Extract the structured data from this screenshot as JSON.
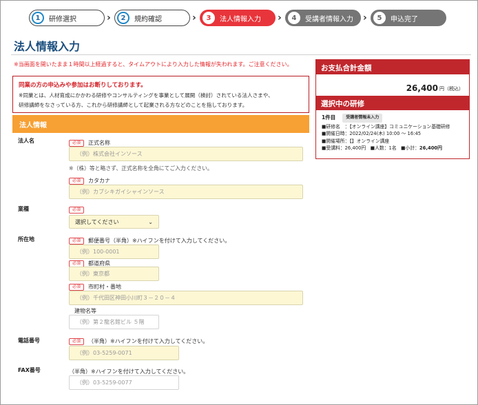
{
  "stepper": [
    {
      "num": "1",
      "label": "研修選択"
    },
    {
      "num": "2",
      "label": "規約確認"
    },
    {
      "num": "3",
      "label": "法人情報入力"
    },
    {
      "num": "4",
      "label": "受講者情報入力"
    },
    {
      "num": "5",
      "label": "申込完了"
    }
  ],
  "page_title": "法人情報入力",
  "timeout_warning": "※当画面を開いたまま１時間以上経過すると、タイムアウトにより入力した情報が失われます。ご注意ください。",
  "notice": {
    "heading": "同業の方の申込みや参加はお断りしております。",
    "body_line1": "※同業とは、人材育成にかかわる研修やコンサルティングを事業として展開（検討）されている法人さまや、",
    "body_line2": "研修講師をなさっている方、これから研修講師として起業される方などのことを指しております。"
  },
  "section_title": "法人情報",
  "required_badge": "必須",
  "form": {
    "company": {
      "label": "法人名",
      "name_label": "正式名称",
      "name_placeholder": "（例）株式会社インソース",
      "name_note": "※（株）等と略さず、正式名称を全角にてご入力ください。",
      "kana_label": "カタカナ",
      "kana_placeholder": "（例）カブシキガイシャインソース"
    },
    "industry": {
      "label": "業種",
      "select_value": "選択してください"
    },
    "address": {
      "label": "所在地",
      "zip_label": "郵便番号（半角）※ハイフンを付けて入力してください。",
      "zip_placeholder": "（例）100-0001",
      "pref_label": "都道府県",
      "pref_placeholder": "（例）東京都",
      "city_label": "市町村・番地",
      "city_placeholder": "（例）千代田区神田小川町３－２０－４",
      "building_label": "建物名等",
      "building_placeholder": "（例）第２龍名館ビル ５階"
    },
    "phone": {
      "label": "電話番号",
      "hint": "（半角）※ハイフンを付けて入力してください。",
      "placeholder": "（例）03-5259-0071"
    },
    "fax": {
      "label": "FAX番号",
      "hint": "（半角）※ハイフンを付けて入力してください。",
      "placeholder": "（例）03-5259-0077"
    }
  },
  "summary": {
    "total_heading": "お支払合計金額",
    "total_value": "26,400",
    "total_unit": "円（税込）",
    "selected_heading": "選択中の研修",
    "item_no": "1件目",
    "item_status": "受講者情報未入力",
    "course_line": "■研修名　：【オンライン講座】コミュニケーション基礎研修",
    "date_line": "■開催日時：2022/02/24(木) 10:00 ～ 16:45",
    "place_line": "■開催場所：【】オンライン講座",
    "fee_label": "■受講料：26,400円",
    "people_label": "■人数：1名",
    "subtotal_label": "■小計：",
    "subtotal_value": "26,400円"
  }
}
